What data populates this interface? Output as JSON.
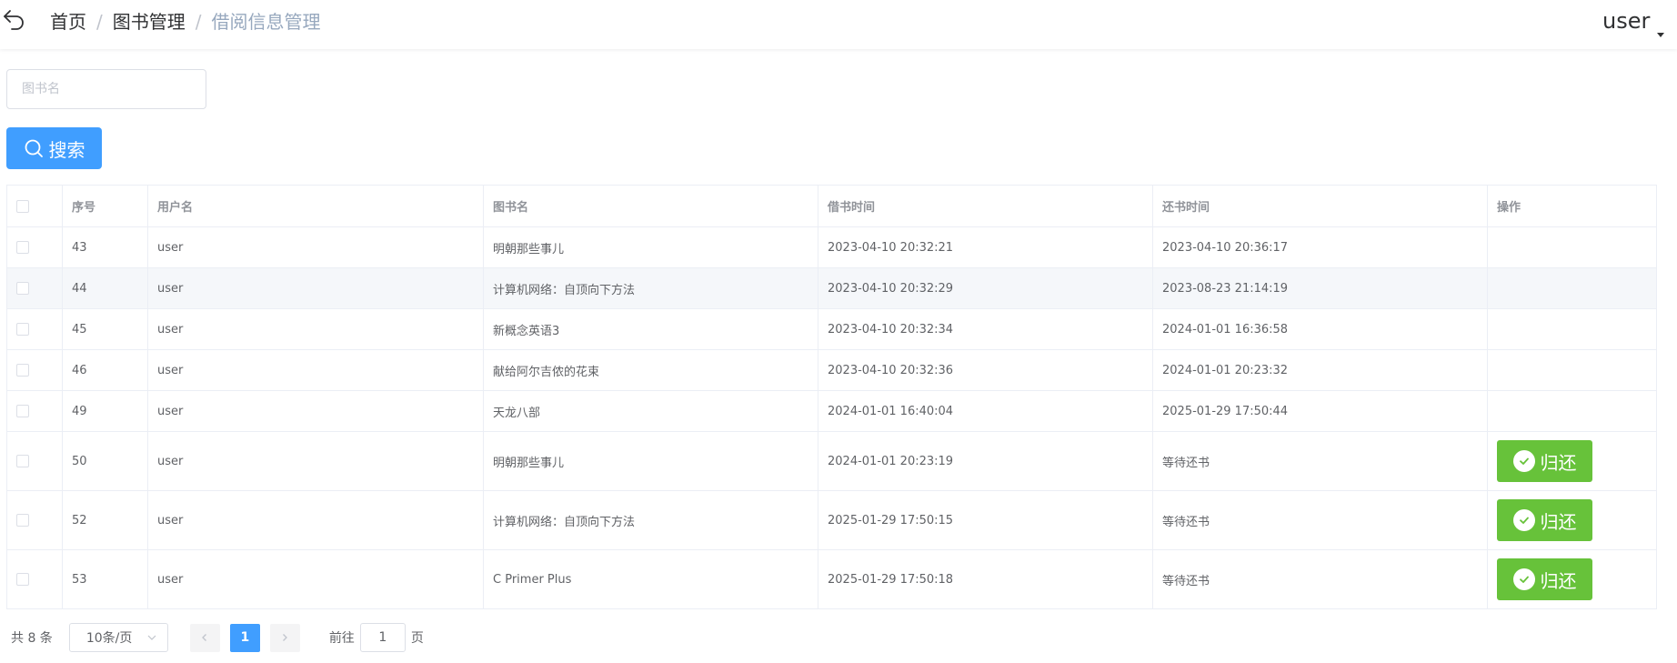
{
  "header": {
    "breadcrumb": [
      "首页",
      "图书管理",
      "借阅信息管理"
    ],
    "separator": "/",
    "user": "user"
  },
  "search": {
    "placeholder": "图书名",
    "value": "",
    "button_label": "搜索"
  },
  "table": {
    "columns": [
      "序号",
      "用户名",
      "图书名",
      "借书时间",
      "还书时间",
      "操作"
    ],
    "rows": [
      {
        "id": "43",
        "username": "user",
        "book": "明朝那些事儿",
        "borrow_time": "2023-04-10 20:32:21",
        "return_time": "2023-04-10 20:36:17",
        "status": "returned"
      },
      {
        "id": "44",
        "username": "user",
        "book": "计算机网络：自顶向下方法",
        "borrow_time": "2023-04-10 20:32:29",
        "return_time": "2023-08-23 21:14:19",
        "status": "returned"
      },
      {
        "id": "45",
        "username": "user",
        "book": "新概念英语3",
        "borrow_time": "2023-04-10 20:32:34",
        "return_time": "2024-01-01 16:36:58",
        "status": "returned"
      },
      {
        "id": "46",
        "username": "user",
        "book": "献给阿尔吉侬的花束",
        "borrow_time": "2023-04-10 20:32:36",
        "return_time": "2024-01-01 20:23:32",
        "status": "returned"
      },
      {
        "id": "49",
        "username": "user",
        "book": "天龙八部",
        "borrow_time": "2024-01-01 16:40:04",
        "return_time": "2025-01-29 17:50:44",
        "status": "returned"
      },
      {
        "id": "50",
        "username": "user",
        "book": "明朝那些事儿",
        "borrow_time": "2024-01-01 20:23:19",
        "return_time": "等待还书",
        "status": "pending"
      },
      {
        "id": "52",
        "username": "user",
        "book": "计算机网络：自顶向下方法",
        "borrow_time": "2025-01-29 17:50:15",
        "return_time": "等待还书",
        "status": "pending"
      },
      {
        "id": "53",
        "username": "user",
        "book": "C Primer Plus",
        "borrow_time": "2025-01-29 17:50:18",
        "return_time": "等待还书",
        "status": "pending"
      }
    ],
    "return_button_label": "归还"
  },
  "pagination": {
    "total_label": "共 8 条",
    "page_size_label": "10条/页",
    "current_page": "1",
    "goto_prefix": "前往",
    "goto_value": "1",
    "goto_suffix": "页"
  },
  "colors": {
    "primary": "#409eff",
    "success": "#67c23a",
    "returned_text": "#19a319",
    "pending_text": "#ff0000"
  }
}
